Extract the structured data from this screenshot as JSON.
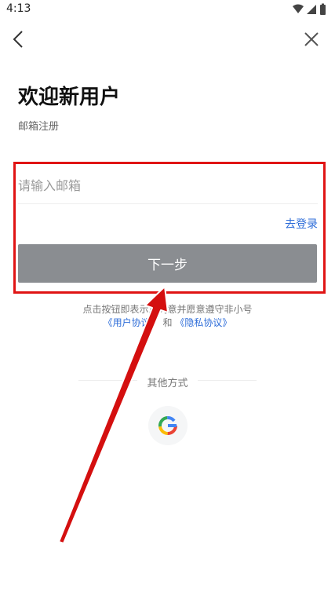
{
  "status_bar": {
    "time": "4:13",
    "icons": [
      "wifi-icon",
      "signal-icon",
      "battery-icon"
    ]
  },
  "nav": {
    "back_icon": "chevron-left-icon",
    "close_icon": "close-icon"
  },
  "header": {
    "title": "欢迎新用户",
    "subtitle": "邮箱注册"
  },
  "form": {
    "email_placeholder": "请输入邮箱",
    "email_value": "",
    "login_link": "去登录",
    "next_button": "下一步"
  },
  "agreement": {
    "line1": "点击按钮即表示您同意并愿意遵守非小号",
    "user_agreement": "《用户协议》",
    "and": " 和 ",
    "privacy_policy": "《隐私协议》"
  },
  "other_methods": {
    "title": "其他方式",
    "google_icon": "google-icon"
  },
  "colors": {
    "accent": "#2b6bd8",
    "button_disabled": "#8a8d91",
    "highlight": "#e01414"
  }
}
